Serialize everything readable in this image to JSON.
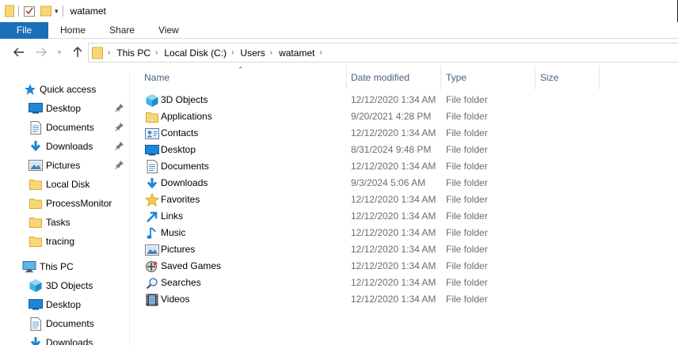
{
  "window": {
    "title": "watamet"
  },
  "ribbon": {
    "tabs": [
      "File",
      "Home",
      "Share",
      "View"
    ]
  },
  "address": {
    "crumbs": [
      "This PC",
      "Local Disk (C:)",
      "Users",
      "watamet"
    ]
  },
  "nav": {
    "quick_access": "Quick access",
    "quick_items": [
      {
        "label": "Desktop",
        "icon": "desktop-icon",
        "pinned": true
      },
      {
        "label": "Documents",
        "icon": "documents-icon",
        "pinned": true
      },
      {
        "label": "Downloads",
        "icon": "downloads-icon",
        "pinned": true
      },
      {
        "label": "Pictures",
        "icon": "pictures-icon",
        "pinned": true
      },
      {
        "label": "Local Disk",
        "icon": "folder-icon",
        "pinned": false
      },
      {
        "label": "ProcessMonitor",
        "icon": "folder-icon",
        "pinned": false
      },
      {
        "label": "Tasks",
        "icon": "folder-icon",
        "pinned": false
      },
      {
        "label": "tracing",
        "icon": "folder-icon",
        "pinned": false
      }
    ],
    "this_pc": "This PC",
    "pc_items": [
      {
        "label": "3D Objects",
        "icon": "3d-objects-icon"
      },
      {
        "label": "Desktop",
        "icon": "desktop-icon"
      },
      {
        "label": "Documents",
        "icon": "documents-icon"
      },
      {
        "label": "Downloads",
        "icon": "downloads-icon"
      }
    ]
  },
  "columns": {
    "name": "Name",
    "date": "Date modified",
    "type": "Type",
    "size": "Size"
  },
  "files": [
    {
      "name": "3D Objects",
      "date": "12/12/2020 1:34 AM",
      "type": "File folder",
      "icon": "3d-objects-icon"
    },
    {
      "name": "Applications",
      "date": "9/20/2021 4:28 PM",
      "type": "File folder",
      "icon": "folder-icon"
    },
    {
      "name": "Contacts",
      "date": "12/12/2020 1:34 AM",
      "type": "File folder",
      "icon": "contacts-icon"
    },
    {
      "name": "Desktop",
      "date": "8/31/2024 9:48 PM",
      "type": "File folder",
      "icon": "desktop-icon"
    },
    {
      "name": "Documents",
      "date": "12/12/2020 1:34 AM",
      "type": "File folder",
      "icon": "documents-icon"
    },
    {
      "name": "Downloads",
      "date": "9/3/2024 5:06 AM",
      "type": "File folder",
      "icon": "downloads-icon"
    },
    {
      "name": "Favorites",
      "date": "12/12/2020 1:34 AM",
      "type": "File folder",
      "icon": "favorites-icon"
    },
    {
      "name": "Links",
      "date": "12/12/2020 1:34 AM",
      "type": "File folder",
      "icon": "links-icon"
    },
    {
      "name": "Music",
      "date": "12/12/2020 1:34 AM",
      "type": "File folder",
      "icon": "music-icon"
    },
    {
      "name": "Pictures",
      "date": "12/12/2020 1:34 AM",
      "type": "File folder",
      "icon": "pictures-icon"
    },
    {
      "name": "Saved Games",
      "date": "12/12/2020 1:34 AM",
      "type": "File folder",
      "icon": "saved-games-icon"
    },
    {
      "name": "Searches",
      "date": "12/12/2020 1:34 AM",
      "type": "File folder",
      "icon": "searches-icon"
    },
    {
      "name": "Videos",
      "date": "12/12/2020 1:34 AM",
      "type": "File folder",
      "icon": "videos-icon"
    }
  ],
  "colors": {
    "accent": "#1a6fb9",
    "folder": "#f8d775",
    "header_text": "#4c607a"
  }
}
